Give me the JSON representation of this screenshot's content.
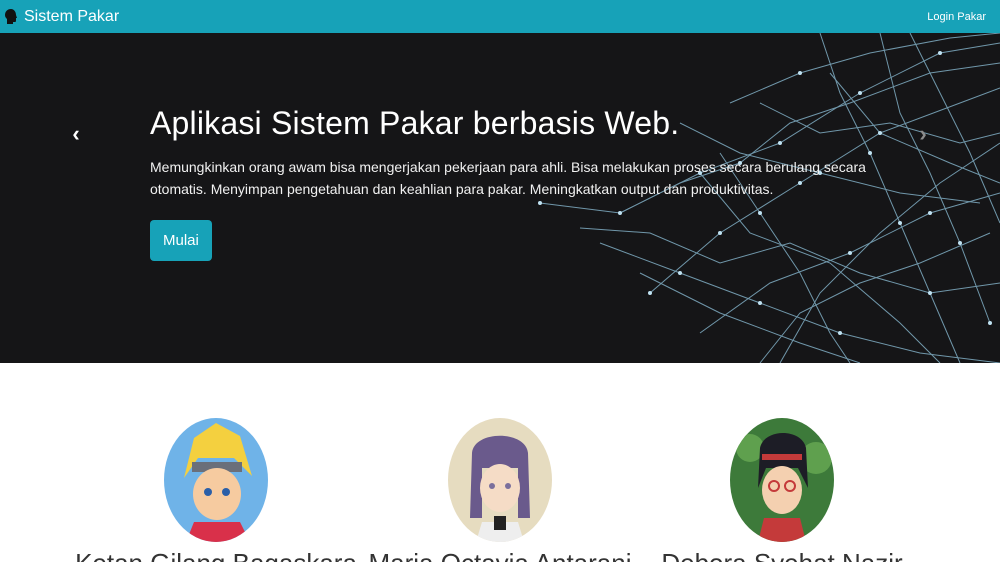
{
  "navbar": {
    "brand": "Sistem Pakar",
    "login": "Login Pakar",
    "brand_icon": "head-icon"
  },
  "hero": {
    "title": "Aplikasi Sistem Pakar berbasis Web.",
    "description": "Memungkinkan orang awam bisa mengerjakan pekerjaan para ahli. Bisa melakukan proses secara berulang secara otomatis. Menyimpan pengetahuan dan keahlian para pakar. Meningkatkan output dan produktivitas.",
    "button": "Mulai",
    "prev_icon": "chevron-left-icon",
    "next_icon": "chevron-right-icon"
  },
  "team": {
    "members": [
      {
        "name": "Ketan Gilang Bagaskara"
      },
      {
        "name": "Maria Octavia Antarani"
      },
      {
        "name": "Debora Syehat Nazir"
      }
    ]
  },
  "colors": {
    "primary": "#17a2b8",
    "hero_bg": "#151517",
    "network_line": "#8fc3dc"
  }
}
